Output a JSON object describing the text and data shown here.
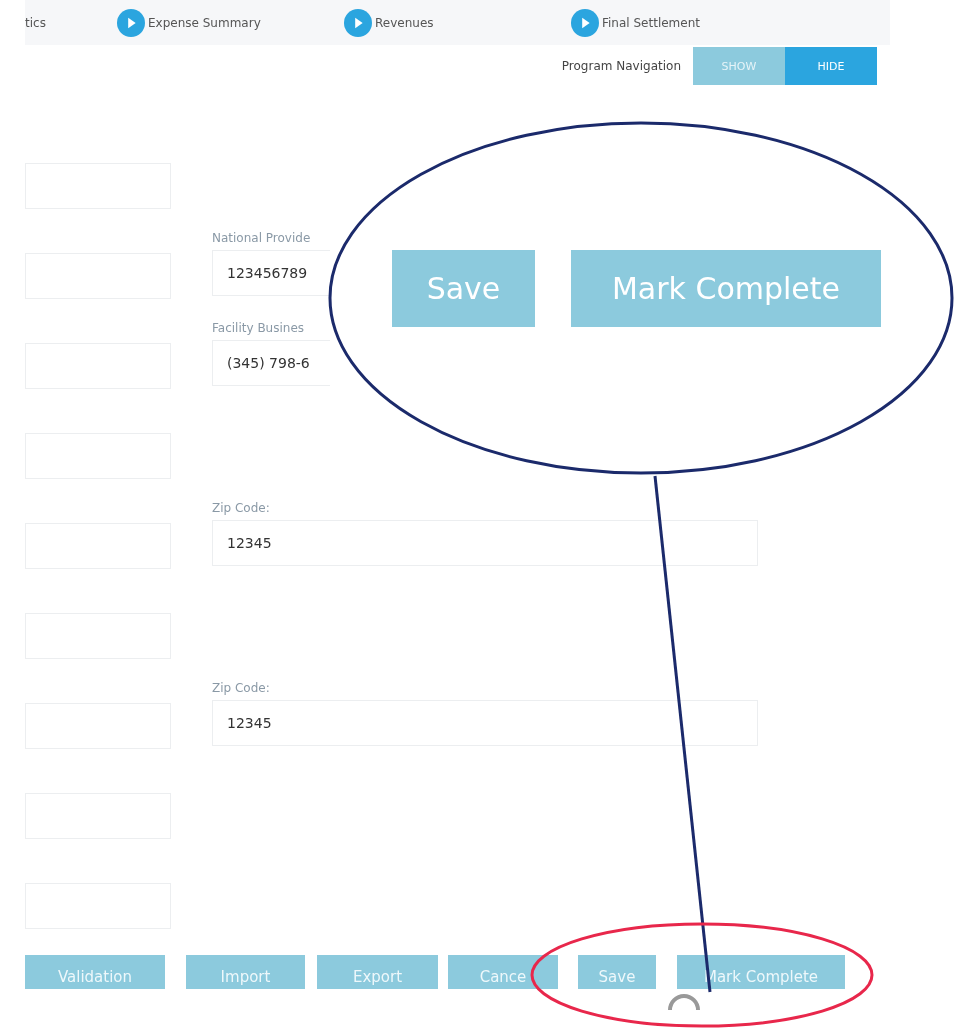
{
  "steps": [
    {
      "label": "tics",
      "icon": false
    },
    {
      "label": "Expense Summary",
      "icon": true
    },
    {
      "label": "Revenues",
      "icon": true
    },
    {
      "label": "Final Settlement",
      "icon": true
    }
  ],
  "program_navigation": {
    "label": "Program Navigation",
    "options": [
      {
        "label": "SHOW",
        "selected": false
      },
      {
        "label": "HIDE",
        "selected": true
      }
    ]
  },
  "form": {
    "rows": [
      {
        "kind": "single"
      },
      {
        "kind": "pair_cut",
        "label": "National Provide",
        "value": "123456789"
      },
      {
        "kind": "pair_cut",
        "label": "Facility Busines",
        "value": "(345) 798-6"
      },
      {
        "kind": "single"
      },
      {
        "kind": "pair",
        "label": "Zip Code:",
        "value": "12345"
      },
      {
        "kind": "single"
      },
      {
        "kind": "pair",
        "label": "Zip Code:",
        "value": "12345"
      },
      {
        "kind": "single"
      },
      {
        "kind": "single"
      }
    ]
  },
  "callout": {
    "buttons": [
      "Save",
      "Mark Complete"
    ]
  },
  "actions": [
    "Validation",
    "Import",
    "Export",
    "Cance",
    "Save",
    "Mark Complete"
  ]
}
